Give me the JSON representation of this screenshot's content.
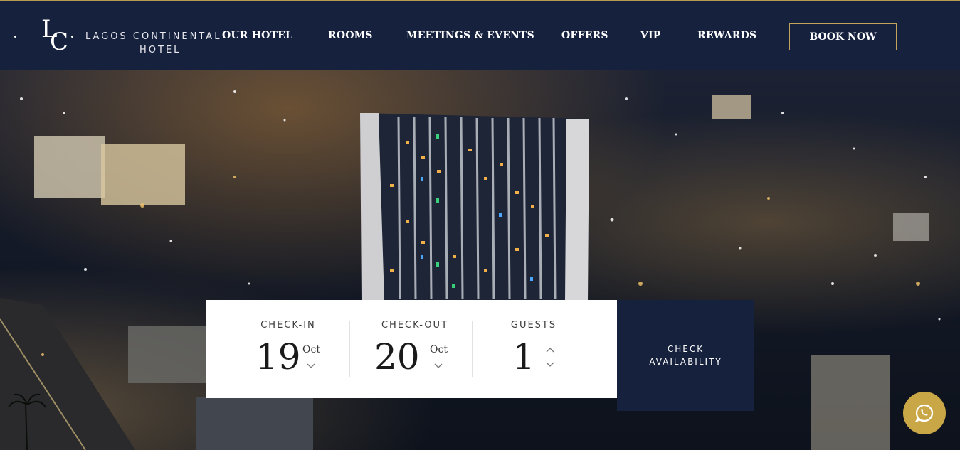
{
  "brand": {
    "name_line1": "LAGOS CONTINENTAL",
    "name_line2": "HOTEL",
    "monogram_l": "L",
    "monogram_c": "C"
  },
  "nav": {
    "items": [
      {
        "label": "OUR HOTEL"
      },
      {
        "label": "ROOMS"
      },
      {
        "label": "MEETINGS & EVENTS"
      },
      {
        "label": "OFFERS"
      },
      {
        "label": "VIP"
      },
      {
        "label": "REWARDS"
      }
    ],
    "book_now": "BOOK NOW"
  },
  "booking": {
    "checkin": {
      "label": "CHECK-IN",
      "day": "19",
      "month": "Oct"
    },
    "checkout": {
      "label": "CHECK-OUT",
      "day": "20",
      "month": "Oct"
    },
    "guests": {
      "label": "GUESTS",
      "value": "1"
    },
    "check_availability": "CHECK AVAILABILITY"
  },
  "colors": {
    "navy": "#15213d",
    "gold": "#c3a35b",
    "whatsapp_bg": "#c9a646"
  },
  "icons": {
    "whatsapp": "whatsapp-icon",
    "chevron_down": "chevron-down-icon",
    "chevron_up": "chevron-up-icon"
  }
}
